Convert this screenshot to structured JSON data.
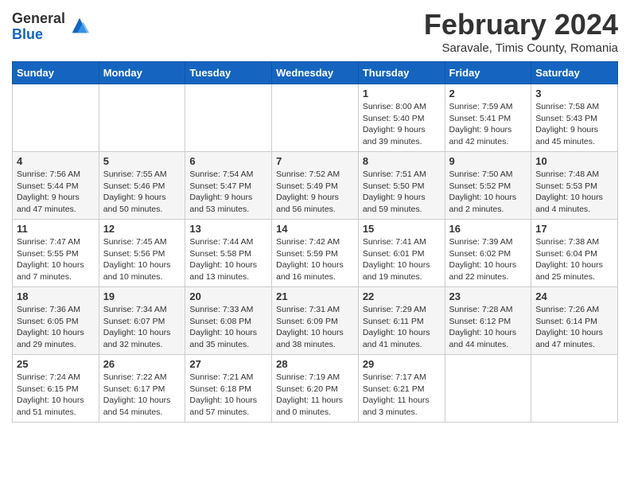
{
  "logo": {
    "general": "General",
    "blue": "Blue"
  },
  "title": "February 2024",
  "location": "Saravale, Timis County, Romania",
  "days_header": [
    "Sunday",
    "Monday",
    "Tuesday",
    "Wednesday",
    "Thursday",
    "Friday",
    "Saturday"
  ],
  "weeks": [
    [
      {
        "day": "",
        "info": ""
      },
      {
        "day": "",
        "info": ""
      },
      {
        "day": "",
        "info": ""
      },
      {
        "day": "",
        "info": ""
      },
      {
        "day": "1",
        "info": "Sunrise: 8:00 AM\nSunset: 5:40 PM\nDaylight: 9 hours\nand 39 minutes."
      },
      {
        "day": "2",
        "info": "Sunrise: 7:59 AM\nSunset: 5:41 PM\nDaylight: 9 hours\nand 42 minutes."
      },
      {
        "day": "3",
        "info": "Sunrise: 7:58 AM\nSunset: 5:43 PM\nDaylight: 9 hours\nand 45 minutes."
      }
    ],
    [
      {
        "day": "4",
        "info": "Sunrise: 7:56 AM\nSunset: 5:44 PM\nDaylight: 9 hours\nand 47 minutes."
      },
      {
        "day": "5",
        "info": "Sunrise: 7:55 AM\nSunset: 5:46 PM\nDaylight: 9 hours\nand 50 minutes."
      },
      {
        "day": "6",
        "info": "Sunrise: 7:54 AM\nSunset: 5:47 PM\nDaylight: 9 hours\nand 53 minutes."
      },
      {
        "day": "7",
        "info": "Sunrise: 7:52 AM\nSunset: 5:49 PM\nDaylight: 9 hours\nand 56 minutes."
      },
      {
        "day": "8",
        "info": "Sunrise: 7:51 AM\nSunset: 5:50 PM\nDaylight: 9 hours\nand 59 minutes."
      },
      {
        "day": "9",
        "info": "Sunrise: 7:50 AM\nSunset: 5:52 PM\nDaylight: 10 hours\nand 2 minutes."
      },
      {
        "day": "10",
        "info": "Sunrise: 7:48 AM\nSunset: 5:53 PM\nDaylight: 10 hours\nand 4 minutes."
      }
    ],
    [
      {
        "day": "11",
        "info": "Sunrise: 7:47 AM\nSunset: 5:55 PM\nDaylight: 10 hours\nand 7 minutes."
      },
      {
        "day": "12",
        "info": "Sunrise: 7:45 AM\nSunset: 5:56 PM\nDaylight: 10 hours\nand 10 minutes."
      },
      {
        "day": "13",
        "info": "Sunrise: 7:44 AM\nSunset: 5:58 PM\nDaylight: 10 hours\nand 13 minutes."
      },
      {
        "day": "14",
        "info": "Sunrise: 7:42 AM\nSunset: 5:59 PM\nDaylight: 10 hours\nand 16 minutes."
      },
      {
        "day": "15",
        "info": "Sunrise: 7:41 AM\nSunset: 6:01 PM\nDaylight: 10 hours\nand 19 minutes."
      },
      {
        "day": "16",
        "info": "Sunrise: 7:39 AM\nSunset: 6:02 PM\nDaylight: 10 hours\nand 22 minutes."
      },
      {
        "day": "17",
        "info": "Sunrise: 7:38 AM\nSunset: 6:04 PM\nDaylight: 10 hours\nand 25 minutes."
      }
    ],
    [
      {
        "day": "18",
        "info": "Sunrise: 7:36 AM\nSunset: 6:05 PM\nDaylight: 10 hours\nand 29 minutes."
      },
      {
        "day": "19",
        "info": "Sunrise: 7:34 AM\nSunset: 6:07 PM\nDaylight: 10 hours\nand 32 minutes."
      },
      {
        "day": "20",
        "info": "Sunrise: 7:33 AM\nSunset: 6:08 PM\nDaylight: 10 hours\nand 35 minutes."
      },
      {
        "day": "21",
        "info": "Sunrise: 7:31 AM\nSunset: 6:09 PM\nDaylight: 10 hours\nand 38 minutes."
      },
      {
        "day": "22",
        "info": "Sunrise: 7:29 AM\nSunset: 6:11 PM\nDaylight: 10 hours\nand 41 minutes."
      },
      {
        "day": "23",
        "info": "Sunrise: 7:28 AM\nSunset: 6:12 PM\nDaylight: 10 hours\nand 44 minutes."
      },
      {
        "day": "24",
        "info": "Sunrise: 7:26 AM\nSunset: 6:14 PM\nDaylight: 10 hours\nand 47 minutes."
      }
    ],
    [
      {
        "day": "25",
        "info": "Sunrise: 7:24 AM\nSunset: 6:15 PM\nDaylight: 10 hours\nand 51 minutes."
      },
      {
        "day": "26",
        "info": "Sunrise: 7:22 AM\nSunset: 6:17 PM\nDaylight: 10 hours\nand 54 minutes."
      },
      {
        "day": "27",
        "info": "Sunrise: 7:21 AM\nSunset: 6:18 PM\nDaylight: 10 hours\nand 57 minutes."
      },
      {
        "day": "28",
        "info": "Sunrise: 7:19 AM\nSunset: 6:20 PM\nDaylight: 11 hours\nand 0 minutes."
      },
      {
        "day": "29",
        "info": "Sunrise: 7:17 AM\nSunset: 6:21 PM\nDaylight: 11 hours\nand 3 minutes."
      },
      {
        "day": "",
        "info": ""
      },
      {
        "day": "",
        "info": ""
      }
    ]
  ]
}
